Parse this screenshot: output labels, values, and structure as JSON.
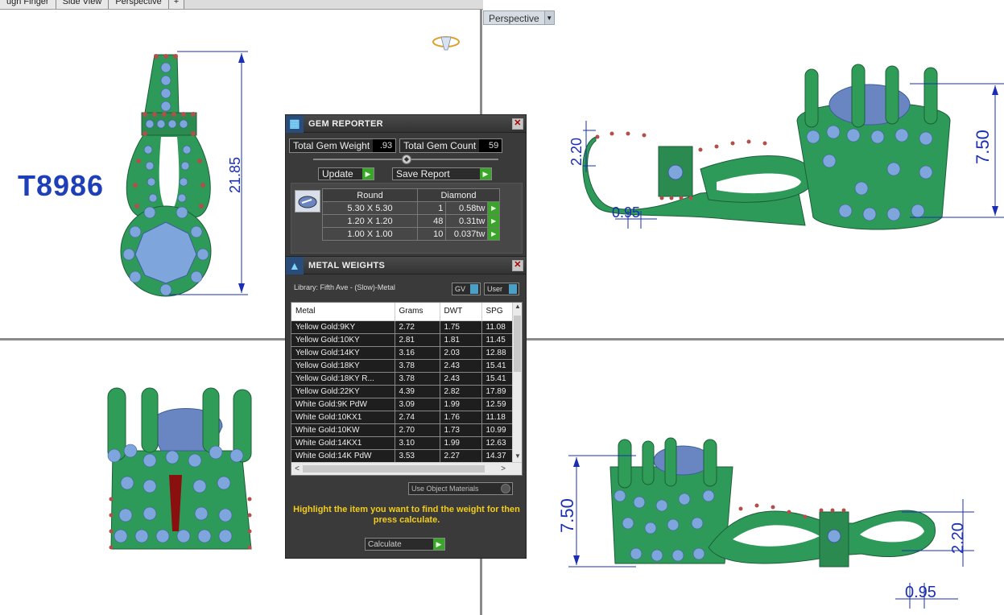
{
  "tabs": [
    {
      "label": "ugh Finger"
    },
    {
      "label": "Side View"
    },
    {
      "label": "Perspective"
    },
    {
      "label": "+"
    }
  ],
  "viewport": {
    "perspective_label": "Perspective"
  },
  "model": {
    "code": "T8986"
  },
  "dimensions": {
    "front_height": "21.85",
    "right_height": "7.50",
    "right_left": "2.20",
    "right_bottom": "0.95",
    "lower_left_height": "7.50",
    "lower_right": "2.20",
    "lower_bottom": "0.95"
  },
  "gem_reporter": {
    "title": "GEM REPORTER",
    "total_weight_label": "Total Gem Weight",
    "total_weight": ".93",
    "total_count_label": "Total Gem Count",
    "total_count": "59",
    "update_label": "Update",
    "save_label": "Save Report",
    "shape_header": "Round",
    "type_header": "Diamond",
    "rows": [
      {
        "size": "5.30 X 5.30",
        "count": "1",
        "weight": "0.58tw"
      },
      {
        "size": "1.20 X 1.20",
        "count": "48",
        "weight": "0.31tw"
      },
      {
        "size": "1.00 X 1.00",
        "count": "10",
        "weight": "0.037tw"
      }
    ]
  },
  "metal_weights": {
    "title": "METAL WEIGHTS",
    "library": "Library: Fifth Ave - (Slow)-Metal",
    "gv_label": "GV",
    "user_label": "User",
    "headers": {
      "metal": "Metal",
      "grams": "Grams",
      "dwt": "DWT",
      "spg": "SPG"
    },
    "rows": [
      {
        "metal": "Yellow Gold:9KY",
        "grams": "2.72",
        "dwt": "1.75",
        "spg": "11.08"
      },
      {
        "metal": "Yellow Gold:10KY",
        "grams": "2.81",
        "dwt": "1.81",
        "spg": "11.45"
      },
      {
        "metal": "Yellow Gold:14KY",
        "grams": "3.16",
        "dwt": "2.03",
        "spg": "12.88"
      },
      {
        "metal": "Yellow Gold:18KY",
        "grams": "3.78",
        "dwt": "2.43",
        "spg": "15.41"
      },
      {
        "metal": "Yellow Gold:18KY R...",
        "grams": "3.78",
        "dwt": "2.43",
        "spg": "15.41"
      },
      {
        "metal": "Yellow Gold:22KY",
        "grams": "4.39",
        "dwt": "2.82",
        "spg": "17.89"
      },
      {
        "metal": "White Gold:9K PdW",
        "grams": "3.09",
        "dwt": "1.99",
        "spg": "12.59"
      },
      {
        "metal": "White Gold:10KX1",
        "grams": "2.74",
        "dwt": "1.76",
        "spg": "11.18"
      },
      {
        "metal": "White Gold:10KW",
        "grams": "2.70",
        "dwt": "1.73",
        "spg": "10.99"
      },
      {
        "metal": "White Gold:14KX1",
        "grams": "3.10",
        "dwt": "1.99",
        "spg": "12.63"
      },
      {
        "metal": "White Gold:14K PdW",
        "grams": "3.53",
        "dwt": "2.27",
        "spg": "14.37"
      }
    ],
    "use_object_label": "Use Object Materials",
    "hint": "Highlight the item you want to find the weight for then press calculate.",
    "calculate_label": "Calculate"
  },
  "colors": {
    "metal_green": "#2e9a5a",
    "gem_blue": "#7fa6dc",
    "bead_red": "#b0504a",
    "dimension_blue": "#1a2fb0",
    "hint_yellow": "#f2cc1a"
  }
}
